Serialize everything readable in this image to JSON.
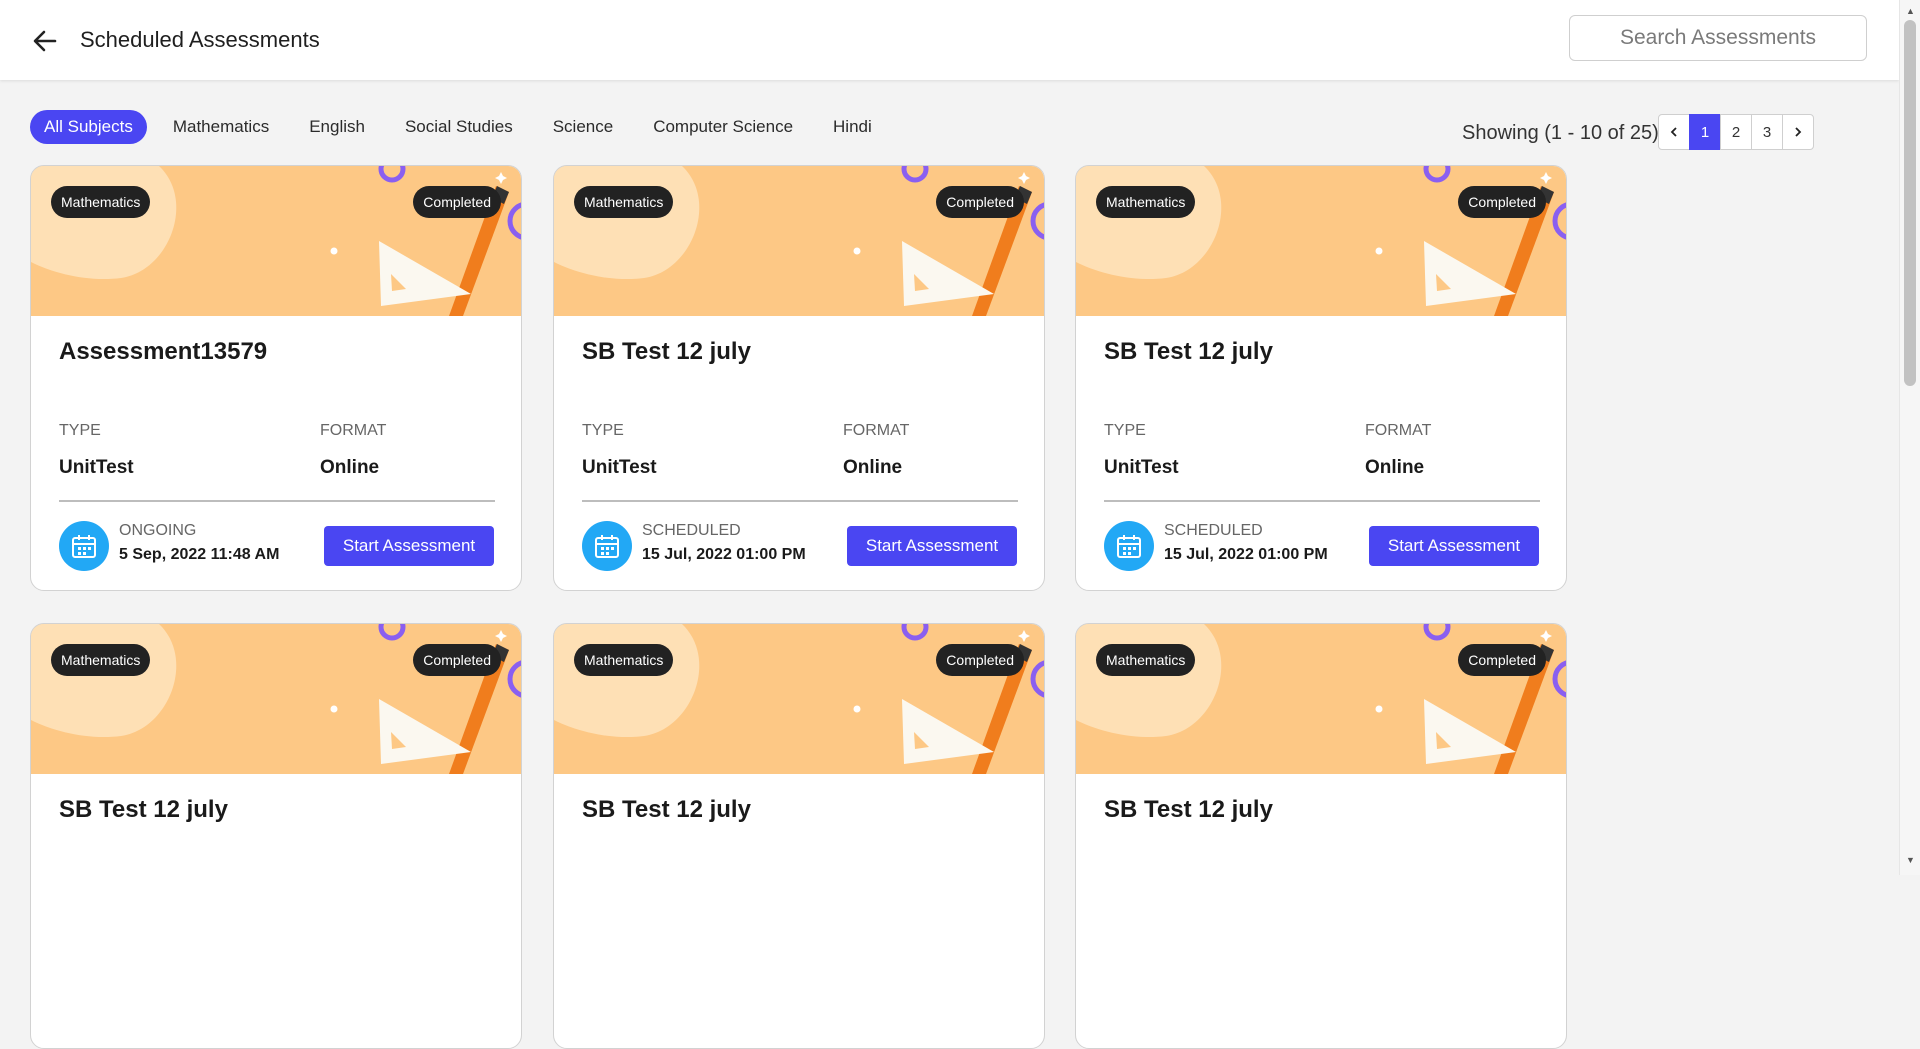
{
  "header": {
    "title": "Scheduled Assessments",
    "back_icon": "arrow-left-icon",
    "search_placeholder": "Search Assessments"
  },
  "filters": [
    {
      "label": "All Subjects",
      "active": true
    },
    {
      "label": "Mathematics",
      "active": false
    },
    {
      "label": "English",
      "active": false
    },
    {
      "label": "Social Studies",
      "active": false
    },
    {
      "label": "Science",
      "active": false
    },
    {
      "label": "Computer Science",
      "active": false
    },
    {
      "label": "Hindi",
      "active": false
    }
  ],
  "pagination": {
    "showing": "Showing (1 - 10 of 25)",
    "prev_icon": "chevron-left-icon",
    "next_icon": "chevron-right-icon",
    "pages": [
      "1",
      "2",
      "3"
    ],
    "current_page": "1"
  },
  "labels": {
    "type": "TYPE",
    "format": "FORMAT",
    "start_button": "Start Assessment"
  },
  "cards": [
    {
      "subject": "Mathematics",
      "status": "Completed",
      "title": "Assessment13579",
      "type": "UnitTest",
      "format": "Online",
      "state": "ONGOING",
      "date": "5 Sep, 2022 11:48 AM"
    },
    {
      "subject": "Mathematics",
      "status": "Completed",
      "title": "SB Test 12 july",
      "type": "UnitTest",
      "format": "Online",
      "state": "SCHEDULED",
      "date": "15 Jul, 2022 01:00 PM"
    },
    {
      "subject": "Mathematics",
      "status": "Completed",
      "title": "SB Test 12 july",
      "type": "UnitTest",
      "format": "Online",
      "state": "SCHEDULED",
      "date": "15 Jul, 2022 01:00 PM"
    },
    {
      "subject": "Mathematics",
      "status": "Completed",
      "title": "SB Test 12 july"
    },
    {
      "subject": "Mathematics",
      "status": "Completed",
      "title": "SB Test 12 july"
    },
    {
      "subject": "Mathematics",
      "status": "Completed",
      "title": "SB Test 12 july"
    }
  ],
  "colors": {
    "accent": "#4a46f2",
    "banner": "#fdc885",
    "calendar_icon_bg": "#22a8f5",
    "pill_bg": "#222222"
  },
  "icons": {
    "calendar": "calendar-icon",
    "banner": "set-square-ruler-illustration"
  }
}
